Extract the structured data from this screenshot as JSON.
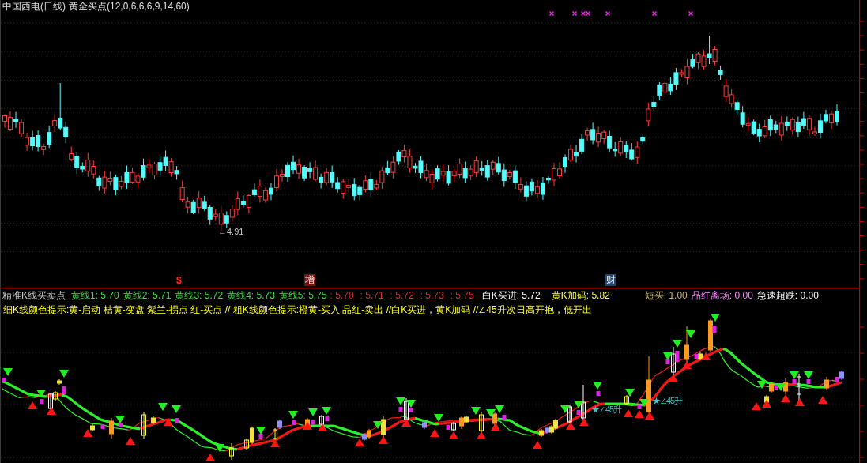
{
  "header": {
    "security": "中国西电(日线)",
    "indicator": "黄金买点(12,0,6,6,6,9,14,60)"
  },
  "price_chart": {
    "low_label": "←4.91",
    "event_marks": [
      {
        "kind": "text",
        "text": "$",
        "color": "#ff2a2a"
      },
      {
        "kind": "tag",
        "text": "增",
        "color": "#800c0c"
      },
      {
        "kind": "tag",
        "text": "财",
        "color": "#1c4470"
      }
    ]
  },
  "indicator_panel": {
    "title": "精准K线买卖点",
    "lines": [
      "黄线1: 5.70",
      "黄线2: 5.71",
      "黄线3: 5.72",
      "黄线4: 5.73",
      "黄线5: 5.75"
    ],
    "line_values": [
      ": 5.70",
      ": 5.71",
      ": 5.72",
      ": 5.73",
      ": 5.75"
    ],
    "readings": [
      {
        "text": "白K买进: 5.72",
        "color": "#ffffff"
      },
      {
        "text": "黄K加码: 5.82",
        "color": "#ffff3c"
      }
    ],
    "alerts": [
      {
        "text": "短买: 1.00",
        "color": "#c8b46e"
      },
      {
        "text": "品红离场: 0.00",
        "color": "#ff8cff"
      },
      {
        "text": "急速超跌: 0.00",
        "color": "#ffffff"
      }
    ],
    "note": "细K线颜色提示:黄-启动 桔黄-变盘 紫兰-拐点 红-买点 // 粗K线颜色提示:橙黄-买入 品红-卖出 //白K买进，黄K加码 //∠45升次日高开抱，低开出",
    "chart_labels": [
      "★∠45升",
      "★∠45升"
    ]
  }
}
